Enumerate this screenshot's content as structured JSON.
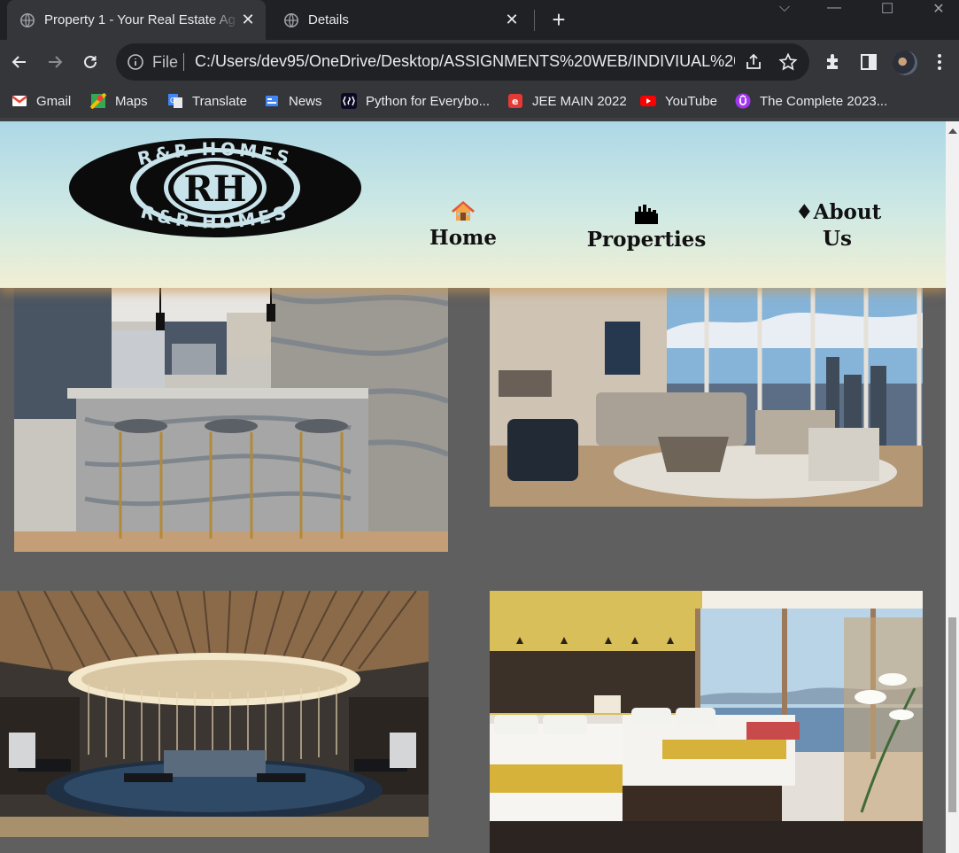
{
  "browser": {
    "tabs": [
      {
        "title": "Property 1 - Your Real Estate Ag",
        "active": true
      },
      {
        "title": "Details",
        "active": false
      }
    ],
    "omnibox": {
      "scheme_label": "File",
      "url": "C:/Users/dev95/OneDrive/Desktop/ASSIGNMENTS%20WEB/INDIVIUAL%20P..."
    },
    "bookmarks": [
      {
        "label": "Gmail",
        "icon": "gmail-icon",
        "color": "#ea4335"
      },
      {
        "label": "Maps",
        "icon": "maps-icon",
        "color": "#34a853"
      },
      {
        "label": "Translate",
        "icon": "translate-icon",
        "color": "#4285f4"
      },
      {
        "label": "News",
        "icon": "news-icon",
        "color": "#4285f4"
      },
      {
        "label": "Python for Everybo...",
        "icon": "freecodecamp-icon",
        "color": "#0a0a23"
      },
      {
        "label": "JEE MAIN 2022",
        "icon": "jee-icon",
        "color": "#e53935"
      },
      {
        "label": "YouTube",
        "icon": "youtube-icon",
        "color": "#ff0000"
      },
      {
        "label": "The Complete 2023...",
        "icon": "udemy-icon",
        "color": "#a435f0"
      }
    ]
  },
  "site": {
    "logo_text": "R&R HOMES",
    "logo_monogram": "RH",
    "nav": [
      {
        "label": "Home",
        "icon": "house-icon"
      },
      {
        "label": "Properties",
        "icon": "buildings-icon"
      },
      {
        "label_line1": "♦About",
        "label_line2": "Us",
        "icon": "diamond-icon"
      }
    ]
  },
  "gallery": [
    {
      "subject": "kitchen"
    },
    {
      "subject": "living-room"
    },
    {
      "subject": "gym"
    },
    {
      "subject": "bedroom"
    }
  ],
  "colors": {
    "chrome_dark": "#202124",
    "chrome_toolbar": "#35363a",
    "page_bg": "#5f5f5f",
    "header_top": "#acd8e6",
    "header_bottom": "#f1efd3"
  }
}
